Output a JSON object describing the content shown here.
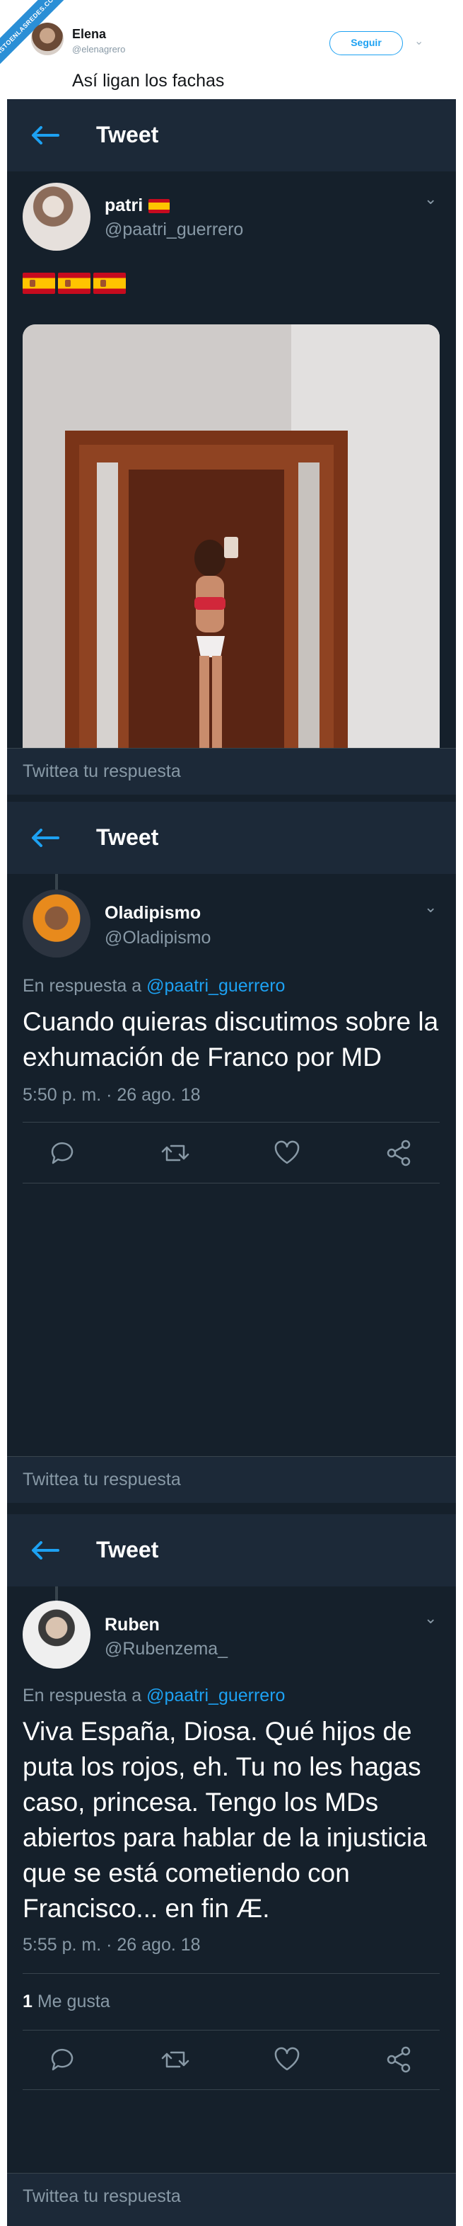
{
  "watermark": {
    "text": "VISTOENLASREDES.COM"
  },
  "header_tweet": {
    "name": "Elena",
    "handle": "@elenagrero",
    "follow_label": "Seguir",
    "text": "Así ligan los fachas"
  },
  "tweets": [
    {
      "appbar_title": "Tweet",
      "name": "patri",
      "handle": "@paatri_guerrero",
      "flags": "🇪🇸🇪🇸🇪🇸",
      "reply_placeholder": "Twittea tu respuesta"
    },
    {
      "appbar_title": "Tweet",
      "name": "Oladipismo",
      "handle": "@Oladipismo",
      "reply_prefix": "En respuesta a",
      "reply_to": "@paatri_guerrero",
      "text": "Cuando quieras discutimos sobre la exhumación de Franco por MD",
      "timestamp": "5:50 p. m. · 26 ago. 18",
      "reply_placeholder": "Twittea tu respuesta"
    },
    {
      "appbar_title": "Tweet",
      "name": "Ruben",
      "handle": "@Rubenzema_",
      "reply_prefix": "En respuesta a",
      "reply_to": "@paatri_guerrero",
      "text": "Viva España, Diosa. Qué hijos de puta los rojos, eh. Tu no les hagas caso, princesa. Tengo los MDs abiertos para hablar de la injusticia que se está cometiendo con Francisco... en fin Æ.",
      "timestamp": "5:55 p. m. · 26 ago. 18",
      "likes_count": "1",
      "likes_label": "Me gusta",
      "reply_placeholder": "Twittea tu respuesta"
    }
  ],
  "colors": {
    "background": "#15202b",
    "appbar": "#1c2938",
    "accent": "#1da1f2",
    "muted": "#8899a6",
    "divider": "#38444d"
  },
  "icons": [
    "back-arrow-icon",
    "chevron-down-icon",
    "reply-icon",
    "retweet-icon",
    "like-icon",
    "share-icon"
  ]
}
